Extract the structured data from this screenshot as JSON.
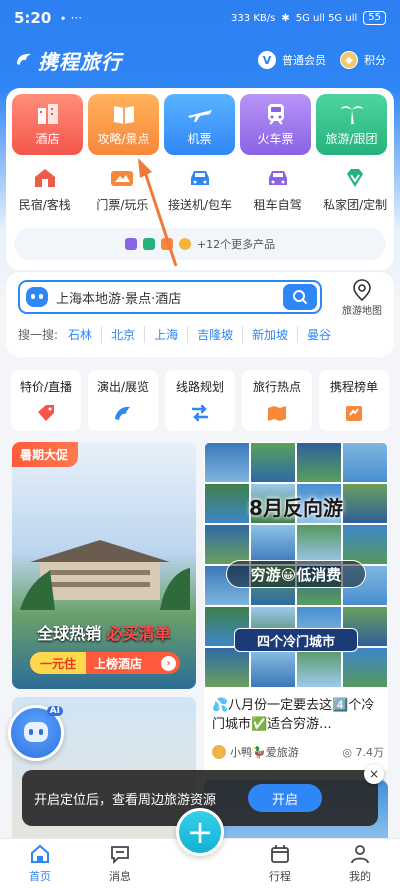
{
  "status": {
    "time": "5:20",
    "dots": "∙ ···",
    "net": "333 KB/s",
    "signal": "5G ull 5G ull",
    "battery": "55"
  },
  "header": {
    "logo": "携程旅行",
    "member_label": "普通会员",
    "member_badge": "V",
    "points_label": "积分"
  },
  "tiles": [
    {
      "label": "酒店",
      "icon": "hotel-icon"
    },
    {
      "label": "攻略/景点",
      "icon": "guide-book-icon"
    },
    {
      "label": "机票",
      "icon": "airplane-icon"
    },
    {
      "label": "火车票",
      "icon": "train-icon"
    },
    {
      "label": "旅游/跟团",
      "icon": "palm-tree-icon"
    }
  ],
  "subs": [
    {
      "label": "民宿/客栈",
      "icon": "house-icon"
    },
    {
      "label": "门票/玩乐",
      "icon": "ticket-icon"
    },
    {
      "label": "接送机/包车",
      "icon": "car-icon"
    },
    {
      "label": "租车自驾",
      "icon": "rental-car-icon"
    },
    {
      "label": "私家团/定制",
      "icon": "diamond-icon"
    }
  ],
  "more_products": "+12个更多产品",
  "search": {
    "placeholder": "上海本地游·景点·酒店",
    "map_label": "旅游地图"
  },
  "hot_search": {
    "label": "搜一搜:",
    "words": [
      "石林",
      "北京",
      "上海",
      "吉隆坡",
      "新加坡",
      "曼谷"
    ]
  },
  "quick": [
    {
      "label": "特价/直播",
      "icon": "sale-tag-icon"
    },
    {
      "label": "演出/展览",
      "icon": "dolphin-icon"
    },
    {
      "label": "线路规划",
      "icon": "route-icon"
    },
    {
      "label": "旅行热点",
      "icon": "flame-map-icon"
    },
    {
      "label": "携程榜单",
      "icon": "ranking-icon"
    }
  ],
  "feed": {
    "promo": {
      "tag": "暑期大促",
      "line_white": "全球热销",
      "line_red": "必买清单",
      "yellow": "一元住",
      "white": "上榜酒店"
    },
    "article": {
      "big": "8月反向游",
      "mid": "穷游😀低消费",
      "low": "四个冷门城市",
      "desc": "💦八月份一定要去这4️⃣个冷门城市✅适合穷游...",
      "author": "小鸭🦆爱旅游",
      "views": "7.4万"
    }
  },
  "ai_label": "AI",
  "toast": {
    "text": "开启定位后，查看周边旅游资源",
    "button": "开启",
    "close": "×"
  },
  "tabs": [
    {
      "label": "首页",
      "icon": "home-icon"
    },
    {
      "label": "消息",
      "icon": "message-icon"
    },
    {
      "label": "",
      "icon": "plus-icon"
    },
    {
      "label": "行程",
      "icon": "calendar-icon"
    },
    {
      "label": "我的",
      "icon": "person-icon"
    }
  ],
  "colors": {
    "brand_blue": "#2f86f5",
    "hotel": "#f4564c",
    "guide": "#f7873a",
    "flight": "#2f86f5",
    "train": "#8a63e6",
    "tour": "#25b37c"
  }
}
